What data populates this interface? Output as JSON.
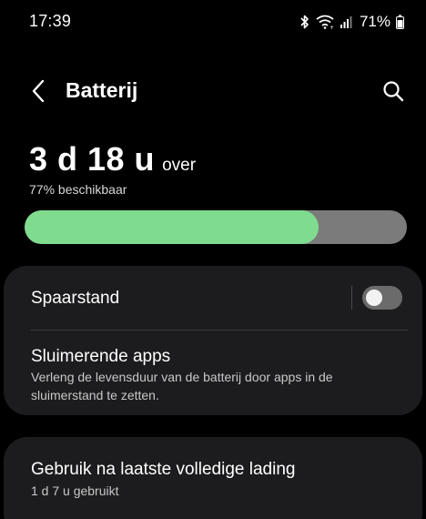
{
  "status_bar": {
    "time": "17:39",
    "battery_percent": "71%",
    "icons": [
      "bluetooth-icon",
      "wifi-icon",
      "signal-icon",
      "battery-icon"
    ]
  },
  "header": {
    "title": "Batterij",
    "back_icon": "chevron-left-icon",
    "search_icon": "search-icon"
  },
  "battery": {
    "remaining": "3 d 18 u",
    "remaining_suffix": "over",
    "available": "77% beschikbaar",
    "level_percent": 77,
    "fill_color": "#7fdc8e",
    "track_color": "#7b7b7b"
  },
  "settings": {
    "power_saving": {
      "label": "Spaarstand",
      "enabled": false
    },
    "sleeping_apps": {
      "label": "Sluimerende apps",
      "description": "Verleng de levensduur van de batterij door apps in de sluimerstand te zetten."
    }
  },
  "usage": {
    "label": "Gebruik na laatste volledige lading",
    "subtitle": "1 d 7 u gebruikt"
  }
}
